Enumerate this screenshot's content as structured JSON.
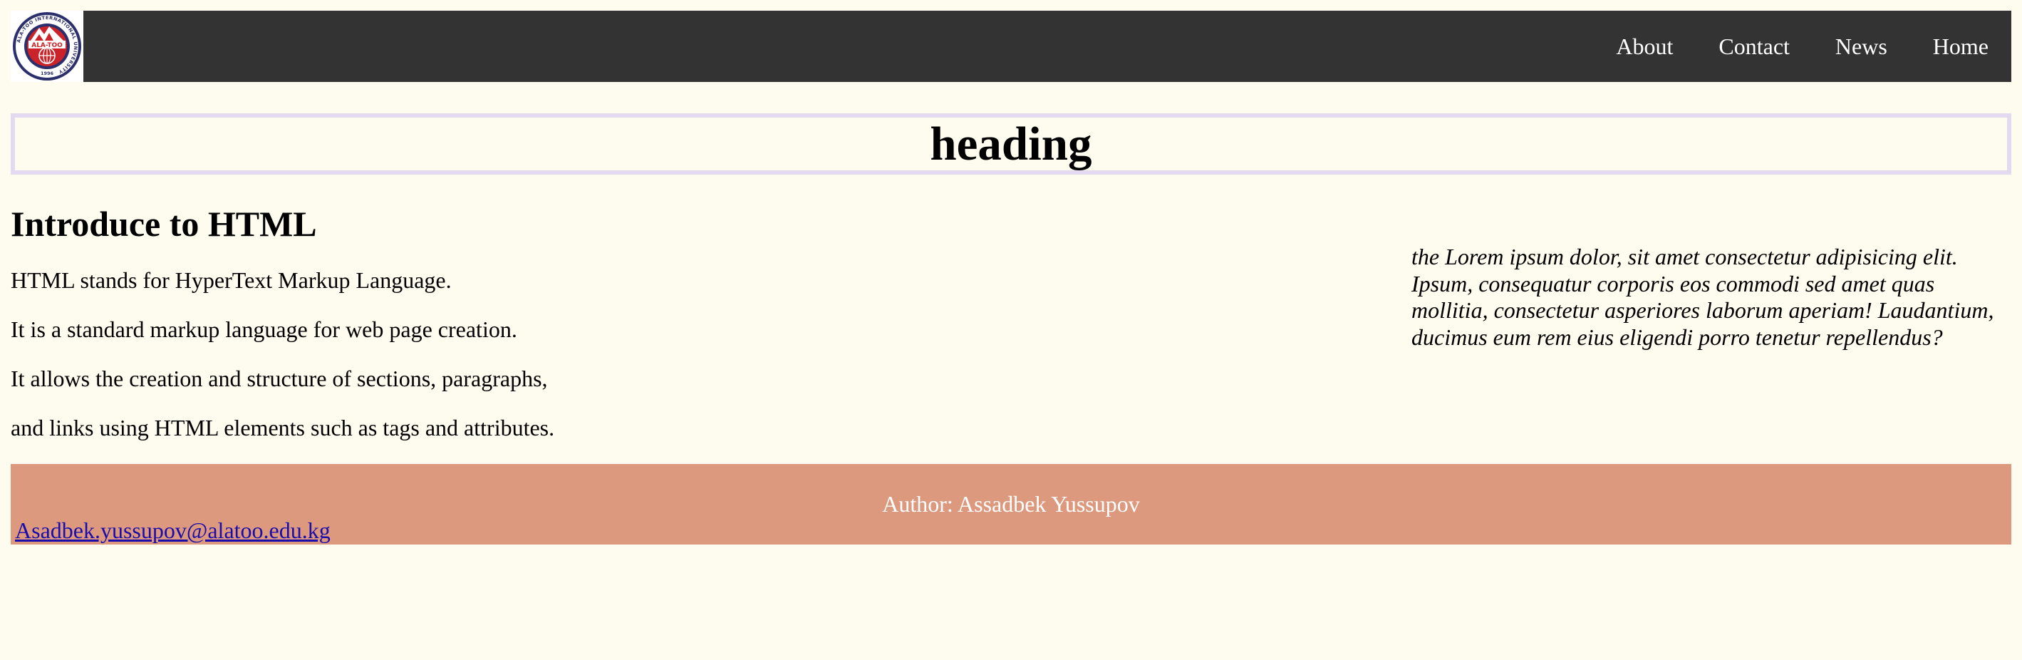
{
  "navbar": {
    "logo": {
      "ring_text": "ALA-TOO INTERNATIONAL UNIVERSITY",
      "center_text": "ALA-TOO",
      "year": "1996"
    },
    "links": [
      "Home",
      "News",
      "Contact",
      "About"
    ]
  },
  "heading": "heading",
  "main": {
    "title": "Introduce to HTML",
    "paragraphs": [
      "HTML stands for HyperText Markup Language.",
      "It is a standard markup language for web page creation.",
      "It allows the creation and structure of sections, paragraphs,",
      "and links using HTML elements such as tags and attributes."
    ]
  },
  "aside": {
    "text": "the Lorem ipsum dolor, sit amet consectetur adipisicing elit. Ipsum, consequatur corporis eos commodi sed amet quas mollitia, consectetur asperiores laborum aperiam! Laudantium, ducimus eum rem eius eligendi porro tenetur repellendus?"
  },
  "footer": {
    "author": "Author: Assadbek Yussupov",
    "email": "Asadbek.yussupov@alatoo.edu.kg"
  },
  "colors": {
    "page_background": "#fefbef",
    "navbar_background": "#333333",
    "heading_border": "#e3d9f1",
    "footer_background": "#dd997e",
    "link": "#1a0dab",
    "logo_navy": "#2b2f6b",
    "logo_red": "#cc2229"
  }
}
